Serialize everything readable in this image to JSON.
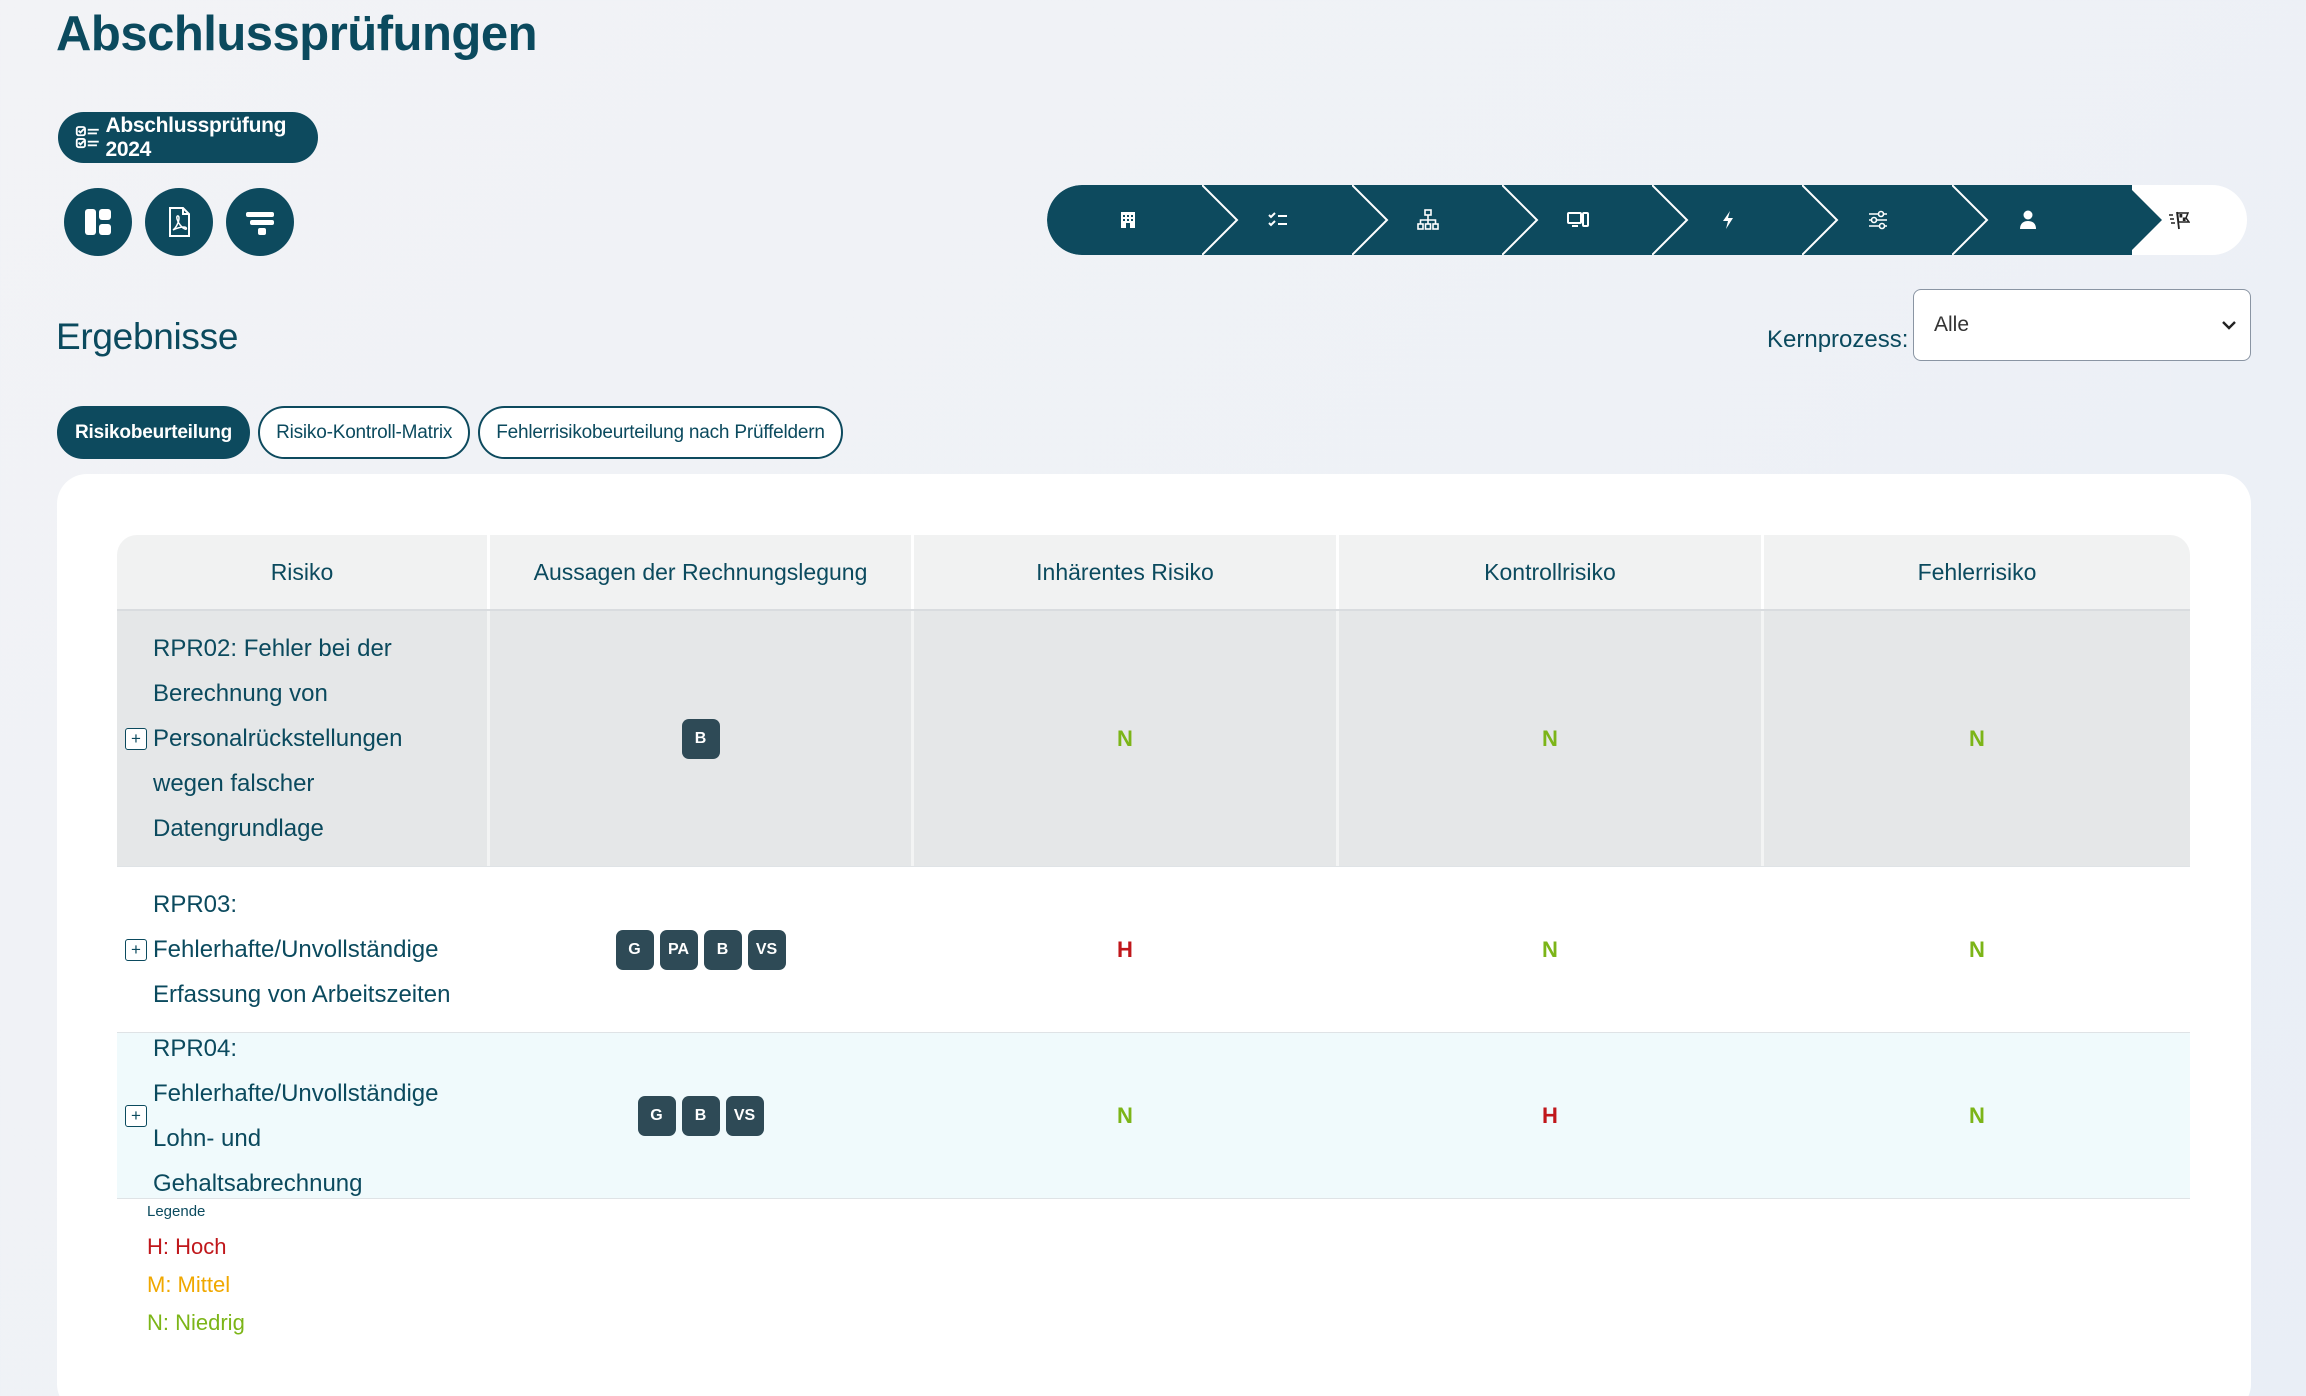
{
  "page": {
    "title": "Abschlussprüfungen"
  },
  "exam": {
    "label": "Abschlussprüfung 2024"
  },
  "toolbar": {
    "buttons": [
      {
        "name": "dashboard-button",
        "icon": "dashboard-icon"
      },
      {
        "name": "pdf-export-button",
        "icon": "pdf-icon"
      },
      {
        "name": "filter-button",
        "icon": "filter-icon"
      }
    ]
  },
  "stepper": {
    "steps": [
      "building-icon",
      "checklist-icon",
      "hierarchy-icon",
      "devices-icon",
      "lightning-icon",
      "sliders-icon",
      "user-icon",
      "finish-flag-icon"
    ],
    "active_index": 7
  },
  "section": {
    "title": "Ergebnisse"
  },
  "filter": {
    "label": "Kernprozess:",
    "value": "Alle"
  },
  "tabs": [
    {
      "label": "Risikobeurteilung",
      "active": true
    },
    {
      "label": "Risiko-Kontroll-Matrix",
      "active": false
    },
    {
      "label": "Fehlerrisikobeurteilung nach Prüffeldern",
      "active": false
    }
  ],
  "table": {
    "headers": [
      "Risiko",
      "Aussagen der Rechnungslegung",
      "Inhärentes Risiko",
      "Kontrollrisiko",
      "Fehlerrisiko"
    ],
    "rows": [
      {
        "risk_lines": [
          "RPR02: Fehler bei der",
          "Berechnung von",
          "Personalrückstellungen",
          "wegen falscher",
          "Datengrundlage"
        ],
        "assertions": [
          "B"
        ],
        "inherent": "N",
        "control": "N",
        "error": "N"
      },
      {
        "risk_lines": [
          "RPR03:",
          "Fehlerhafte/Unvollständige",
          "Erfassung von Arbeitszeiten"
        ],
        "assertions": [
          "G",
          "PA",
          "B",
          "VS"
        ],
        "inherent": "H",
        "control": "N",
        "error": "N"
      },
      {
        "risk_lines": [
          "RPR04:",
          "Fehlerhafte/Unvollständige",
          "Lohn- und Gehaltsabrechnung"
        ],
        "assertions": [
          "G",
          "B",
          "VS"
        ],
        "inherent": "N",
        "control": "H",
        "error": "N"
      }
    ]
  },
  "legend": {
    "title": "Legende",
    "items": [
      {
        "label": "H: Hoch",
        "color": "#c0171b"
      },
      {
        "label": "M: Mittel",
        "color": "#f0a800"
      },
      {
        "label": "N: Niedrig",
        "color": "#7cb518"
      }
    ]
  },
  "colors": {
    "primary": "#0d4a5e",
    "high": "#c0171b",
    "medium": "#f0a800",
    "low": "#7cb518"
  }
}
